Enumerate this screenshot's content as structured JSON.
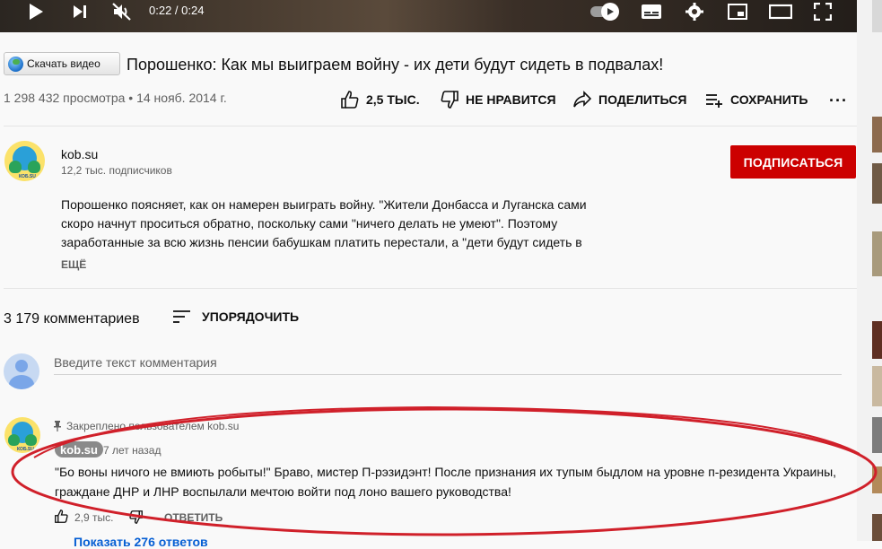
{
  "player": {
    "time": "0:22 / 0:24"
  },
  "video": {
    "download_button": "Скачать видео",
    "title": "Порошенко: Как мы выиграем войну - их дети будут сидеть в подвалах!",
    "meta": "1 298 432 просмотра • 14 нояб. 2014 г.",
    "likes": "2,5 ТЫС.",
    "dislike": "НЕ НРАВИТСЯ",
    "share": "ПОДЕЛИТЬСЯ",
    "save": "СОХРАНИТЬ"
  },
  "channel": {
    "name": "kob.su",
    "subscribers": "12,2 тыс. подписчиков",
    "subscribe": "ПОДПИСАТЬСЯ",
    "description": [
      "Порошенко поясняет, как он намерен выиграть войну. \"Жители Донбасса и Луганска сами",
      "скоро начнут проситься обратно, поскольку сами \"ничего делать не умеют\". Поэтому",
      "заработанные за всю жизнь пенсии бабушкам платить перестали, а \"дети будут сидеть в"
    ],
    "more": "ЕЩЁ"
  },
  "comments": {
    "count": "3 179 комментариев",
    "sort": "УПОРЯДОЧИТЬ",
    "placeholder": "Введите текст комментария",
    "pinned": {
      "pinned_label": "Закреплено пользователем kob.su",
      "author": "kob.su",
      "time": "7 лет назад",
      "text": [
        "\"Бо воны ничого не вмиють робыты!\" Браво, мистер П-рэзидэнт! После признания их тупым быдлом на уровне п-резидента Украины,",
        "граждане ДНР и ЛНР воспылали мечтою войти под лоно вашего руководства!"
      ],
      "likes": "2,9 тыс.",
      "reply": "ОТВЕТИТЬ",
      "show_replies": "Показать 276 ответов"
    }
  },
  "colors": {
    "subscribe": "#cc0000",
    "annotation": "#d0202a",
    "link": "#065fd4"
  },
  "icons": [
    "play-icon",
    "next-icon",
    "mute-icon",
    "autoplay-toggle",
    "subtitles-icon",
    "settings-icon",
    "miniplayer-icon",
    "theater-icon",
    "fullscreen-icon",
    "thumb-up-icon",
    "thumb-down-icon",
    "share-icon",
    "save-playlist-icon",
    "more-icon",
    "sort-icon",
    "pin-icon"
  ]
}
